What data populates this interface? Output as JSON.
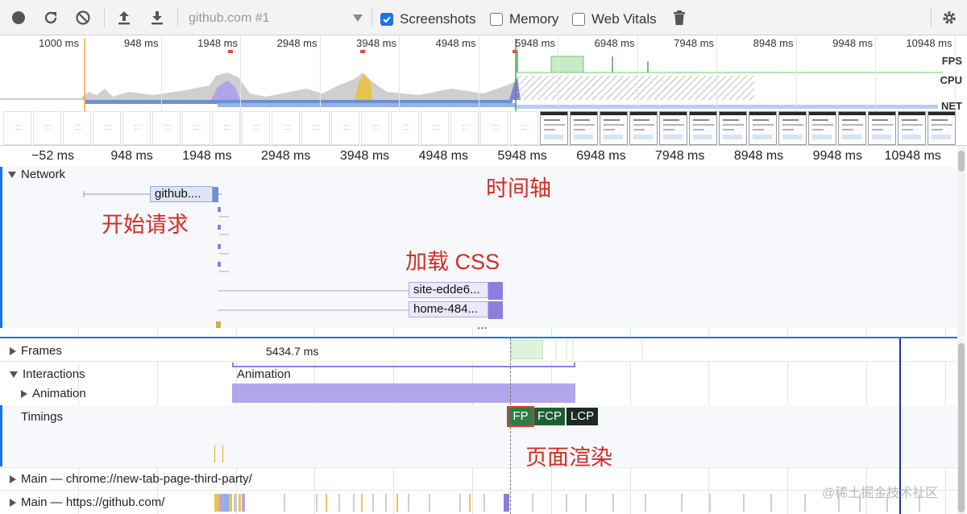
{
  "toolbar": {
    "profile_select": "github.com #1",
    "screenshots_label": "Screenshots",
    "memory_label": "Memory",
    "web_vitals_label": "Web Vitals",
    "screenshots_checked": true,
    "memory_checked": false,
    "web_vitals_checked": false
  },
  "overview": {
    "ticks": [
      "1000 ms",
      "948 ms",
      "1948 ms",
      "2948 ms",
      "3948 ms",
      "4948 ms",
      "5948 ms",
      "6948 ms",
      "7948 ms",
      "8948 ms",
      "9948 ms",
      "10948 ms"
    ],
    "fps_label": "FPS",
    "cpu_label": "CPU",
    "net_label": "NET"
  },
  "ruler": {
    "ticks": [
      "−52 ms",
      "948 ms",
      "1948 ms",
      "2948 ms",
      "3948 ms",
      "4948 ms",
      "5948 ms",
      "6948 ms",
      "7948 ms",
      "8948 ms",
      "9948 ms",
      "10948 ms"
    ]
  },
  "network": {
    "title": "Network",
    "requests": [
      "github....",
      "site-edde6...",
      "home-484..."
    ],
    "more": "..."
  },
  "annotations": {
    "timeline_axis": "时间轴",
    "start_request": "开始请求",
    "load_css": "加载 CSS",
    "page_render": "页面渲染"
  },
  "tracks": {
    "frames": "Frames",
    "frames_duration": "5434.7 ms",
    "interactions": "Interactions",
    "interactions_animation": "Animation",
    "animation": "Animation",
    "timings": "Timings",
    "timing_markers": [
      "FP",
      "FCP",
      "LCP"
    ],
    "main_new_tab": "Main — chrome://new-tab-page-third-party/",
    "main_github": "Main — https://github.com/"
  },
  "watermark": "@稀土掘金技术社区",
  "colors": {
    "record_accent": "#1a73e8",
    "annotation_red": "#d62b22",
    "fp_green": "#2e7d46",
    "fcp_green": "#1e5e34",
    "lcp_dark": "#1c2a22",
    "animation_purple": "#b3a5ea"
  }
}
